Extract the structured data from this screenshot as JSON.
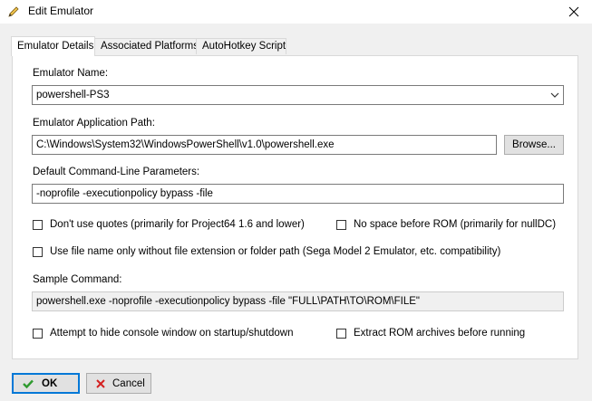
{
  "window": {
    "title": "Edit Emulator"
  },
  "tabs": [
    {
      "label": "Emulator Details"
    },
    {
      "label": "Associated Platforms"
    },
    {
      "label": "AutoHotkey Script"
    }
  ],
  "form": {
    "emulator_name": {
      "label": "Emulator Name:",
      "value": "powershell-PS3"
    },
    "app_path": {
      "label": "Emulator Application Path:",
      "value": "C:\\Windows\\System32\\WindowsPowerShell\\v1.0\\powershell.exe",
      "browse_label": "Browse..."
    },
    "cmd_params": {
      "label": "Default Command-Line Parameters:",
      "value": "-noprofile -executionpolicy bypass -file"
    },
    "options": {
      "dont_use_quotes": "Don't use quotes (primarily for Project64 1.6 and lower)",
      "no_space_before_rom": "No space before ROM (primarily for nullDC)",
      "file_name_only": "Use file name only without file extension or folder path (Sega Model 2 Emulator, etc. compatibility)",
      "hide_console": "Attempt to hide console window on startup/shutdown",
      "extract_rom": "Extract ROM archives before running"
    },
    "sample_command": {
      "label": "Sample Command:",
      "value": "powershell.exe -noprofile -executionpolicy bypass -file \"FULL\\PATH\\TO\\ROM\\FILE\""
    }
  },
  "buttons": {
    "ok": "OK",
    "cancel": "Cancel"
  },
  "icons": {
    "title": "pencil-icon",
    "close": "close-icon",
    "ok": "checkmark-icon",
    "cancel": "x-icon",
    "combo": "chevron-down-icon"
  },
  "colors": {
    "ok_icon": "#2e9a2e",
    "cancel_icon": "#d42020",
    "focus": "#0078d7"
  }
}
